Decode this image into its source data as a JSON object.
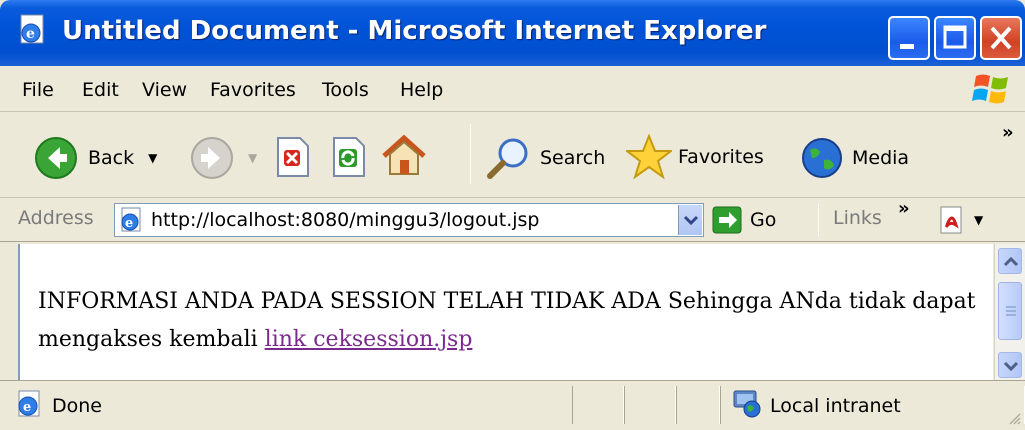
{
  "window": {
    "title": "Untitled Document - Microsoft Internet Explorer"
  },
  "menu": {
    "items": [
      "File",
      "Edit",
      "View",
      "Favorites",
      "Tools",
      "Help"
    ]
  },
  "toolbar": {
    "back_label": "Back",
    "search_label": "Search",
    "favorites_label": "Favorites",
    "media_label": "Media",
    "overflow_label": "»"
  },
  "address": {
    "label": "Address",
    "url": "http://localhost:8080/minggu3/logout.jsp",
    "go_label": "Go",
    "links_label": "Links",
    "links_overflow": "»"
  },
  "content": {
    "message": "INFORMASI ANDA PADA SESSION TELAH TIDAK ADA Sehingga ANda tidak dapat mengakses kembali",
    "link_text": "link ceksession.jsp"
  },
  "status": {
    "text": "Done",
    "zone": "Local intranet"
  },
  "colors": {
    "titlebar": "#0054e3",
    "chrome": "#ece9d8",
    "link_visited": "#7a2a8c"
  },
  "icons": {
    "title": "ie-page-icon",
    "back": "back-arrow-icon",
    "forward": "forward-arrow-icon",
    "stop": "stop-icon",
    "refresh": "refresh-icon",
    "home": "home-icon",
    "search": "search-icon",
    "favorites": "star-icon",
    "media": "globe-icon"
  }
}
